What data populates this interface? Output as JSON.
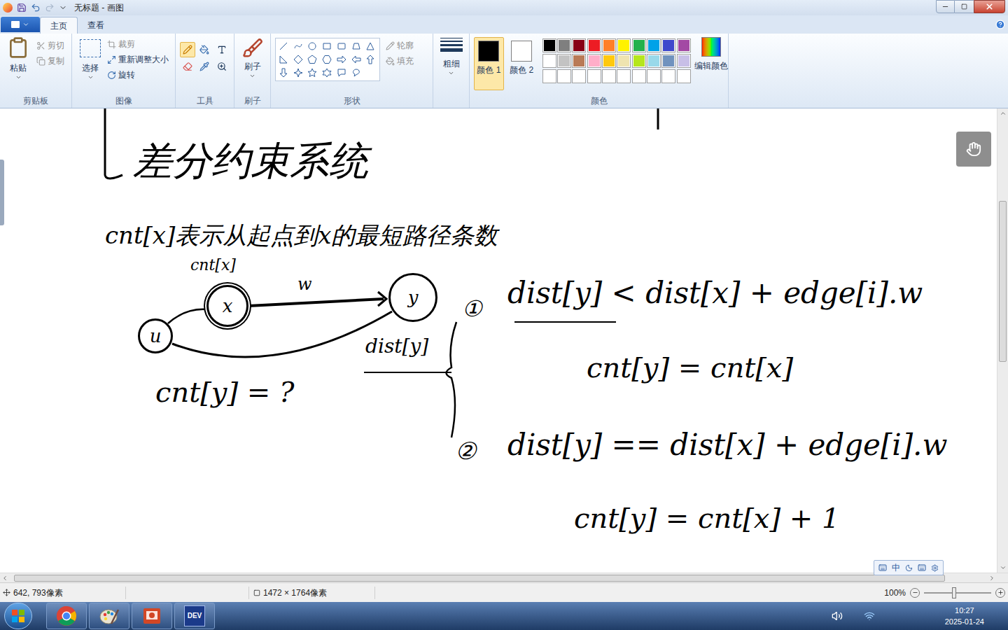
{
  "window": {
    "title": "无标题 - 画图"
  },
  "ribbon_tabs": [
    {
      "label": "主页",
      "selected": true
    },
    {
      "label": "查看",
      "selected": false
    }
  ],
  "clipboard": {
    "label": "剪贴板",
    "paste": "粘贴",
    "items": [
      {
        "label": "剪切",
        "disabled": true
      },
      {
        "label": "复制",
        "disabled": true
      }
    ]
  },
  "image": {
    "label": "图像",
    "select": "选择",
    "items": [
      {
        "label": "裁剪",
        "disabled": true
      },
      {
        "label": "重新调整大小",
        "disabled": false
      },
      {
        "label": "旋转",
        "disabled": false
      }
    ]
  },
  "tools": {
    "label": "工具"
  },
  "brushes": {
    "label": "刷子"
  },
  "shapes": {
    "label": "形状",
    "items": [
      {
        "label": "轮廓",
        "disabled": true
      },
      {
        "label": "填充",
        "disabled": true
      }
    ]
  },
  "size": {
    "label": "粗细"
  },
  "color_slots": [
    {
      "label": "颜色 1",
      "color": "#000000",
      "selected": true
    },
    {
      "label": "颜色 2",
      "color": "#ffffff",
      "selected": false
    }
  ],
  "palette": {
    "label": "颜色",
    "edit": "编辑颜色",
    "colors": [
      "#000000",
      "#7f7f7f",
      "#880015",
      "#ed1c24",
      "#ff7f27",
      "#fff200",
      "#22b14c",
      "#00a2e8",
      "#3f48cc",
      "#a349a4",
      "#ffffff",
      "#c3c3c3",
      "#b97a57",
      "#ffaec9",
      "#ffc90e",
      "#efe4b0",
      "#b5e61d",
      "#99d9ea",
      "#7092be",
      "#c8bfe7",
      "#ffffff",
      "#ffffff",
      "#ffffff",
      "#ffffff",
      "#ffffff",
      "#ffffff",
      "#ffffff",
      "#ffffff",
      "#ffffff",
      "#ffffff"
    ]
  },
  "canvas": {
    "nodes": [
      "u",
      "x",
      "y"
    ],
    "annotations": [
      "差分约束系统",
      "cnt[x]表示从起点到x的最短路径条数",
      "cnt[x]",
      "w",
      "dist[y]",
      "cnt[y] = ?",
      "①",
      "dist[y] < dist[x] + edge[i].w",
      "cnt[y] = cnt[x]",
      "②",
      "dist[y] == dist[x] + edge[i].w",
      "cnt[y] = cnt[x] + 1"
    ]
  },
  "ime": {
    "label": "中"
  },
  "status_bar": {
    "position": "642, 793像素",
    "size": "1472 × 1764像素",
    "zoom": "100%"
  },
  "taskbar": {
    "apps": [
      {
        "kind": "chrome"
      },
      {
        "kind": "paint"
      },
      {
        "kind": "powerpoint"
      },
      {
        "kind": "devcpp",
        "label": "DEV"
      }
    ],
    "time": "10:27",
    "date": "2025-01-24"
  }
}
